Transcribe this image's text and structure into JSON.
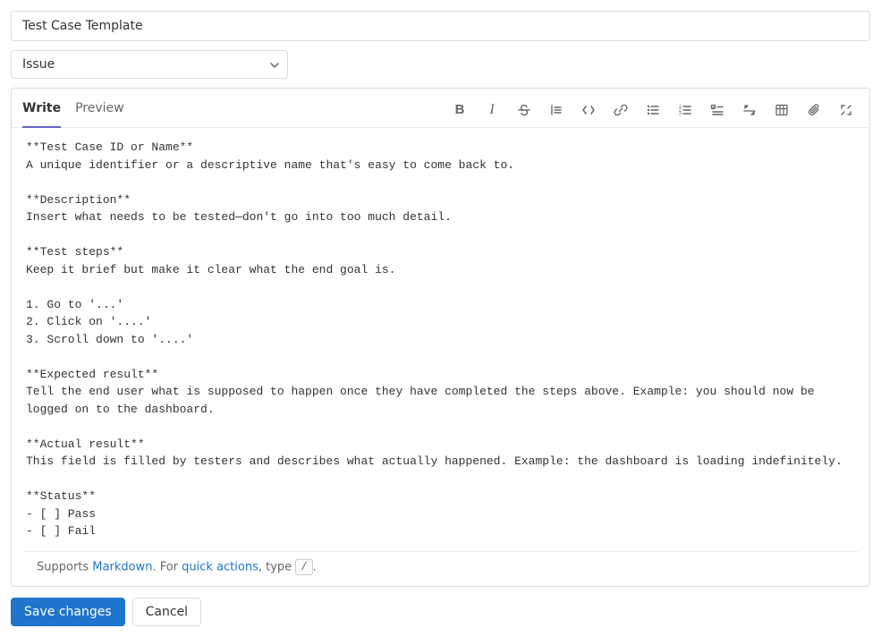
{
  "title_field": {
    "value": "Test Case Template"
  },
  "type_dropdown": {
    "selected": "Issue"
  },
  "tabs": {
    "write": "Write",
    "preview": "Preview"
  },
  "toolbar": {
    "bold": "B",
    "italic": "I",
    "strike": "S",
    "quote": "Quote",
    "code": "Code",
    "link": "Link",
    "ul": "UL",
    "ol": "OL",
    "tasklist": "Tasklist",
    "indent": "Indent",
    "table": "Table",
    "attach": "Attach",
    "fullscreen": "Fullscreen"
  },
  "editor": {
    "content": "**Test Case ID or Name**\nA unique identifier or a descriptive name that's easy to come back to.\n\n**Description**\nInsert what needs to be tested—don't go into too much detail.\n\n**Test steps**\nKeep it brief but make it clear what the end goal is.\n\n1. Go to '...'\n2. Click on '....'\n3. Scroll down to '....'\n\n**Expected result**\nTell the end user what is supposed to happen once they have completed the steps above. Example: you should now be logged on to the dashboard.\n\n**Actual result**\nThis field is filled by testers and describes what actually happened. Example: the dashboard is loading indefinitely.\n\n**Status**\n- [ ] Pass\n- [ ] Fail"
  },
  "footer": {
    "supports": "Supports ",
    "markdown": "Markdown",
    "for": ". For ",
    "quick_actions": "quick actions",
    "type": ", type ",
    "slash": "/",
    "period": "."
  },
  "actions": {
    "save": "Save changes",
    "cancel": "Cancel"
  }
}
